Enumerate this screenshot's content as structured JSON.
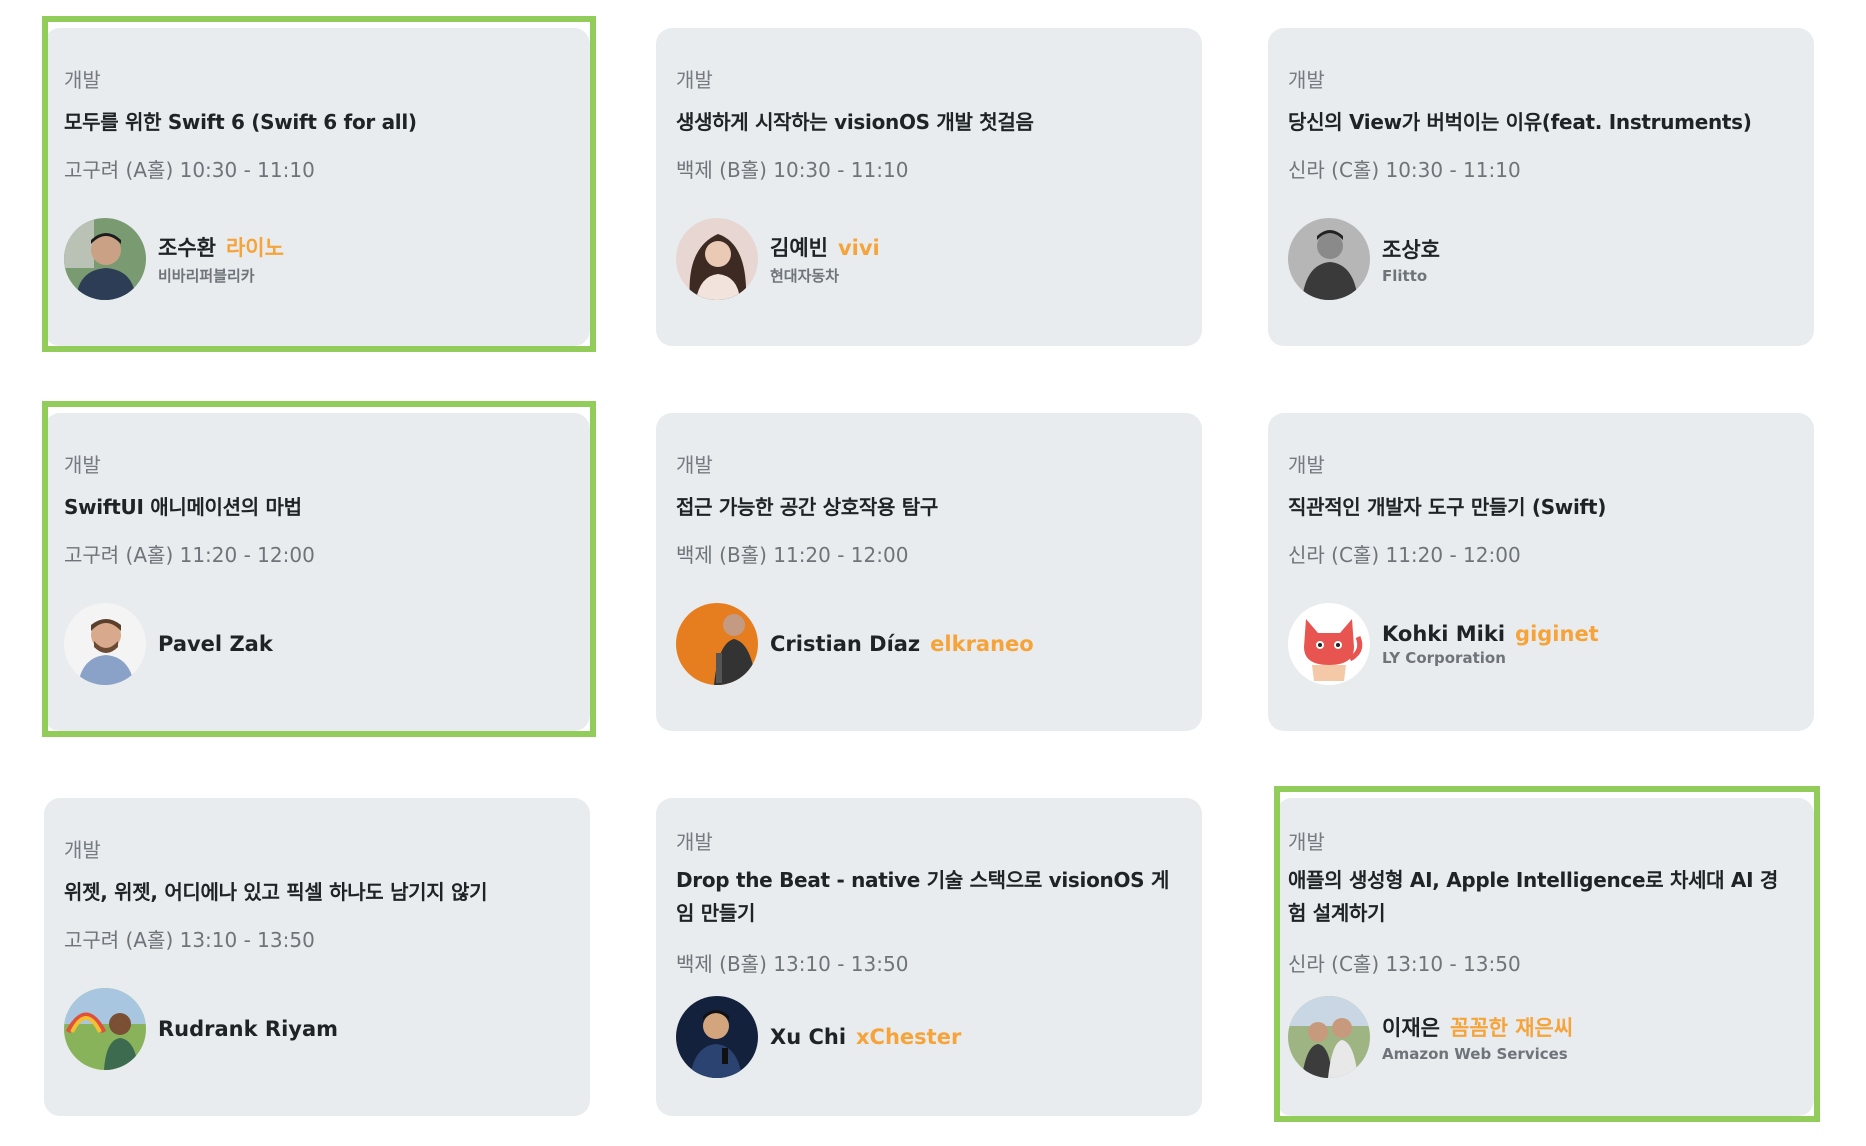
{
  "sessions": [
    {
      "category": "개발",
      "title": "모두를 위한 Swift 6 (Swift 6 for all)",
      "room_time": "고구려 (A홀) 10:30 - 11:10",
      "speaker_name": "조수환",
      "speaker_nick": "라이노",
      "speaker_org": "비바리퍼블리카",
      "avatar_icon": "speaker-photo"
    },
    {
      "category": "개발",
      "title": "생생하게 시작하는 visionOS 개발 첫걸음",
      "room_time": "백제 (B홀) 10:30 - 11:10",
      "speaker_name": "김예빈",
      "speaker_nick": "vivi",
      "speaker_org": "현대자동차",
      "avatar_icon": "speaker-photo"
    },
    {
      "category": "개발",
      "title": "당신의 View가 버벅이는 이유(feat. Instruments)",
      "room_time": "신라 (C홀) 10:30 - 11:10",
      "speaker_name": "조상호",
      "speaker_nick": "",
      "speaker_org": "Flitto",
      "avatar_icon": "speaker-photo"
    },
    {
      "category": "개발",
      "title": "SwiftUI 애니메이션의 마법",
      "room_time": "고구려 (A홀) 11:20 - 12:00",
      "speaker_name": "Pavel Zak",
      "speaker_nick": "",
      "speaker_org": "",
      "avatar_icon": "speaker-photo"
    },
    {
      "category": "개발",
      "title": "접근 가능한 공간 상호작용 탐구",
      "room_time": "백제 (B홀) 11:20 - 12:00",
      "speaker_name": "Cristian Díaz",
      "speaker_nick": "elkraneo",
      "speaker_org": "",
      "avatar_icon": "speaker-photo"
    },
    {
      "category": "개발",
      "title": "직관적인 개발자 도구 만들기 (Swift)",
      "room_time": "신라 (C홀) 11:20 - 12:00",
      "speaker_name": "Kohki Miki",
      "speaker_nick": "giginet",
      "speaker_org": "LY Corporation",
      "avatar_icon": "cartoon-cat-avatar"
    },
    {
      "category": "개발",
      "title": "위젯, 위젯, 어디에나 있고 픽셀 하나도 남기지 않기",
      "room_time": "고구려 (A홀) 13:10 - 13:50",
      "speaker_name": "Rudrank Riyam",
      "speaker_nick": "",
      "speaker_org": "",
      "avatar_icon": "speaker-photo"
    },
    {
      "category": "개발",
      "title": "Drop the Beat - native 기술 스택으로 visionOS 게임 만들기",
      "room_time": "백제 (B홀) 13:10 - 13:50",
      "speaker_name": "Xu Chi",
      "speaker_nick": "xChester",
      "speaker_org": "",
      "avatar_icon": "speaker-photo"
    },
    {
      "category": "개발",
      "title": "애플의 생성형 AI, Apple Intelligence로 차세대 AI 경험 설계하기",
      "room_time": "신라 (C홀) 13:10 - 13:50",
      "speaker_name": "이재은",
      "speaker_nick": "꼼꼼한 재은씨",
      "speaker_org": "Amazon Web Services",
      "avatar_icon": "speaker-photo"
    }
  ],
  "colors": {
    "card_bg": "#e8ecef",
    "highlight_border": "#92cc5b",
    "nickname": "#f6a43a",
    "muted_text": "#6e7479",
    "title_text": "#1f2326"
  }
}
